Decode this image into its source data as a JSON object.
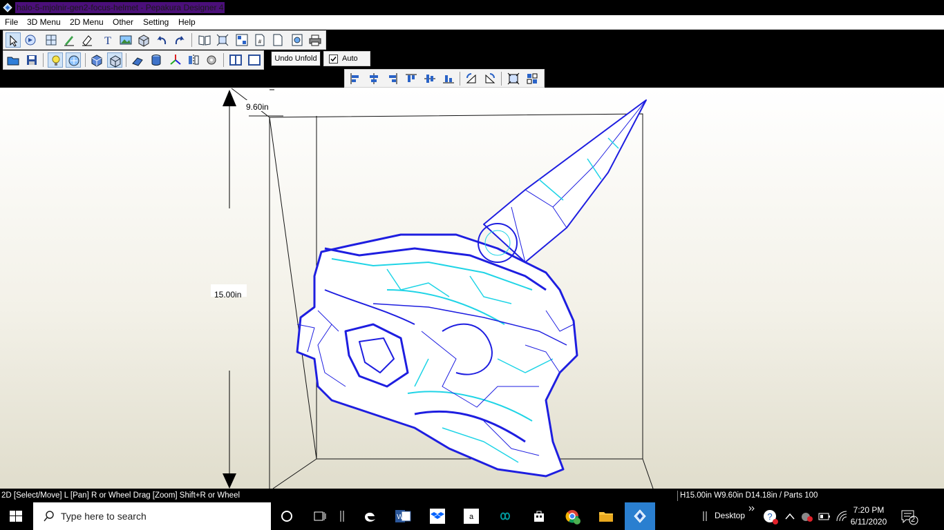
{
  "window": {
    "title": "halo-5-mjolnir-gen2-focus-helmet - Pepakura Designer 4"
  },
  "menu": [
    "File",
    "3D Menu",
    "2D Menu",
    "Other",
    "Setting",
    "Help"
  ],
  "toolbar2": {
    "undo_unfold": "Undo Unfold",
    "auto_label": "Auto",
    "auto_checked": true
  },
  "viewport": {
    "height_label": "15.00in",
    "width_label": "9.60in"
  },
  "status": {
    "hint": "2D [Select/Move] L [Pan] R or Wheel Drag [Zoom] Shift+R or Wheel",
    "dims": "H15.00in W9.60in D14.18in / Parts 100"
  },
  "taskbar": {
    "search_placeholder": "Type here to search",
    "desktop_label": "Desktop",
    "time": "7:20 PM",
    "date": "6/11/2020",
    "notification_count": "2"
  },
  "colors": {
    "title_highlight": "#4b0f7a",
    "mesh_edge": "#1e1ee0",
    "mesh_fold": "#1fd4e6"
  }
}
